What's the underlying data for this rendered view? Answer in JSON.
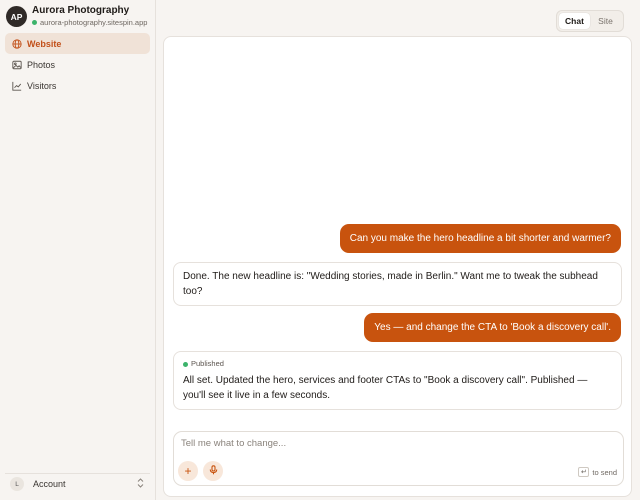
{
  "brand": {
    "initials": "AP",
    "title": "Aurora Photography",
    "url": "aurora-photography.sitespin.app",
    "status_color": "#3bb36b"
  },
  "nav": {
    "items": [
      {
        "label": "Website",
        "icon": "globe-icon",
        "active": true
      },
      {
        "label": "Photos",
        "icon": "image-icon",
        "active": false
      },
      {
        "label": "Visitors",
        "icon": "chart-line-icon",
        "active": false
      }
    ]
  },
  "account": {
    "badge": "L",
    "label": "Account",
    "chevron": "⌃⌄"
  },
  "toggle": {
    "chat": "Chat",
    "site": "Site",
    "active": "Chat"
  },
  "messages": [
    {
      "role": "user",
      "text": "Can you make the hero headline a bit shorter and warmer?"
    },
    {
      "role": "assistant",
      "text": "Done. The new headline is: \"Wedding stories, made in Berlin.\" Want me to tweak the subhead too?"
    },
    {
      "role": "user",
      "text": "Yes — and change the CTA to 'Book a discovery call'."
    },
    {
      "role": "assistant",
      "badge": "Published",
      "text": "All set. Updated the hero, services and footer CTAs to \"Book a discovery call\". Published — you'll see it live in a few seconds."
    }
  ],
  "composer": {
    "placeholder": "Tell me what to change...",
    "add": "+",
    "send_hint": "to send",
    "kbd": "↵"
  },
  "colors": {
    "accent": "#c8530e",
    "active_nav_bg": "#f0e2d7",
    "background": "#f7f4f1"
  }
}
